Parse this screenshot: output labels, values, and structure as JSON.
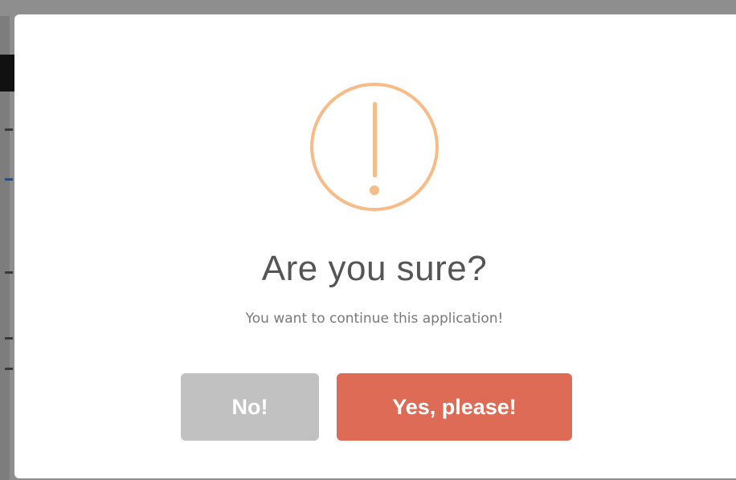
{
  "dialog": {
    "title": "Are you sure?",
    "message": "You want to continue this application!",
    "icon": "warning-exclamation-icon",
    "cancel_label": "No!",
    "confirm_label": "Yes, please!"
  },
  "colors": {
    "warning_icon": "#f8bb86",
    "confirm_button": "#dd6b55",
    "cancel_button": "#c1c1c1",
    "overlay": "#8e8e8e"
  }
}
